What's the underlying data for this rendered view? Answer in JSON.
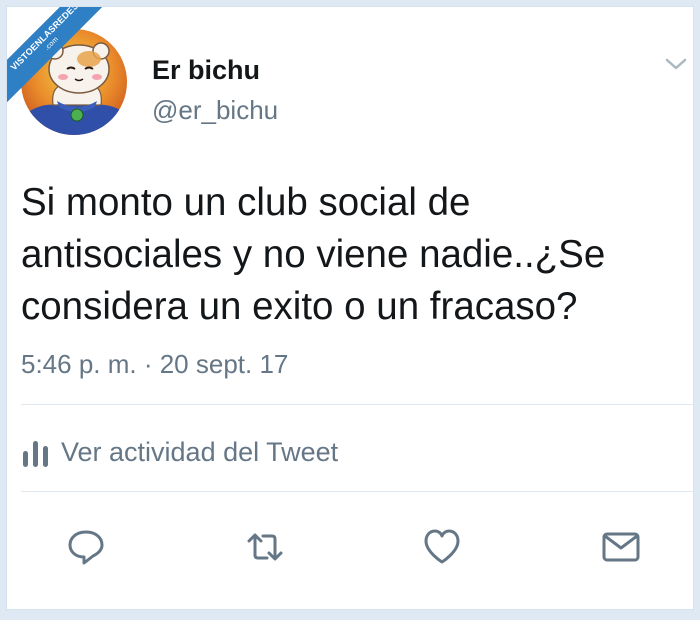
{
  "watermark": {
    "text": "VISTOENLASREDES",
    "domain": ".com"
  },
  "author": {
    "display_name": "Er bichu",
    "handle": "@er_bichu"
  },
  "tweet": {
    "text": "Si monto un club social de\nantisociales y no viene nadie..¿Se\nconsidera un exito o un fracaso?",
    "timestamp": "5:46 p. m. · 20 sept. 17"
  },
  "activity": {
    "label": "Ver actividad del Tweet"
  },
  "actions": [
    "reply-icon",
    "retweet-icon",
    "like-icon",
    "dm-icon"
  ],
  "colors": {
    "text_primary": "#14171a",
    "text_secondary": "#657786",
    "divider": "#e1e8ed",
    "background": "#dfe9f3",
    "watermark": "#2f7fc4"
  }
}
